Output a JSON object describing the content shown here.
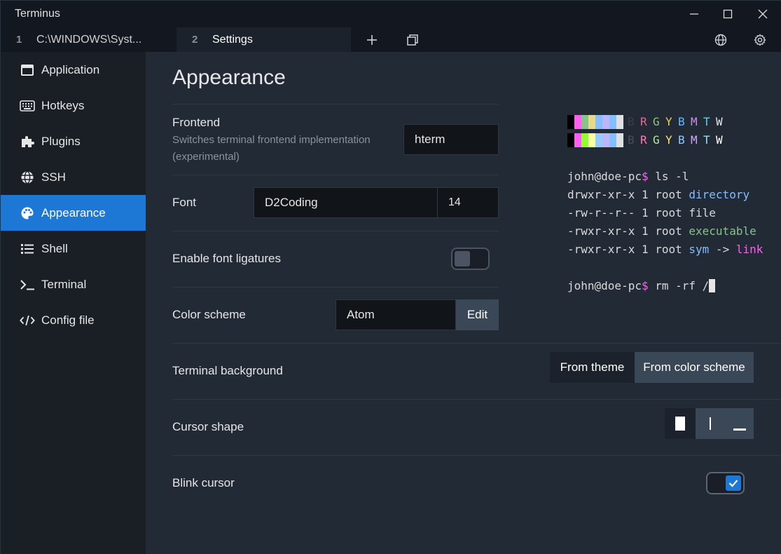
{
  "app": {
    "title": "Terminus"
  },
  "tabs": [
    {
      "num": "1",
      "label": "C:\\WINDOWS\\Syst..."
    },
    {
      "num": "2",
      "label": "Settings"
    }
  ],
  "sidebar": {
    "items": [
      {
        "label": "Application",
        "icon": "window-icon"
      },
      {
        "label": "Hotkeys",
        "icon": "keyboard-icon"
      },
      {
        "label": "Plugins",
        "icon": "puzzle-icon"
      },
      {
        "label": "SSH",
        "icon": "globe-icon"
      },
      {
        "label": "Appearance",
        "icon": "palette-icon",
        "active": true
      },
      {
        "label": "Shell",
        "icon": "list-icon"
      },
      {
        "label": "Terminal",
        "icon": "terminal-icon"
      },
      {
        "label": "Config file",
        "icon": "code-icon"
      }
    ]
  },
  "main": {
    "heading": "Appearance",
    "frontend": {
      "label": "Frontend",
      "description": "Switches terminal frontend implementation (experimental)",
      "value": "hterm"
    },
    "font": {
      "label": "Font",
      "family": "D2Coding",
      "size": "14"
    },
    "ligatures": {
      "label": "Enable font ligatures",
      "enabled": false
    },
    "color_scheme": {
      "label": "Color scheme",
      "value": "Atom",
      "edit_label": "Edit"
    },
    "terminal_background": {
      "label": "Terminal background",
      "options": [
        "From theme",
        "From color scheme"
      ],
      "selected": "From color scheme"
    },
    "cursor_shape": {
      "label": "Cursor shape",
      "options": [
        "block",
        "beam",
        "underline"
      ],
      "selected": "block"
    },
    "blink_cursor": {
      "label": "Blink cursor",
      "enabled": true
    }
  },
  "preview": {
    "letters": [
      "B",
      "R",
      "G",
      "Y",
      "B",
      "M",
      "T",
      "W"
    ],
    "letter_colors_normal": [
      "#3a3f47",
      "#e06c9a",
      "#98c379",
      "#e5d352",
      "#6cb6ff",
      "#c792ea",
      "#6bcbe8",
      "#e6e6e6"
    ],
    "letter_colors_bright": [
      "#4a505a",
      "#ff7ab2",
      "#b6f08a",
      "#ffe16b",
      "#8ec8ff",
      "#d7a6ff",
      "#8fe0f5",
      "#ffffff"
    ],
    "swatch_normal": [
      "#000000",
      "#fd5ff1",
      "#87c38a",
      "#e5d98b",
      "#85befd",
      "#b9b6fc",
      "#85befd",
      "#e0e0e0"
    ],
    "swatch_bright": [
      "#000000",
      "#fd5ff1",
      "#94fa36",
      "#f5ffa8",
      "#96cbfe",
      "#b9b6fc",
      "#85befd",
      "#e0e0e0"
    ],
    "prompt_user": "john@doe-pc",
    "prompt_symbol": "$",
    "command1": " ls -l",
    "listing": [
      {
        "perms": "drwxr-xr-x 1 root ",
        "name": "directory",
        "color": "#85befd"
      },
      {
        "perms": "-rw-r--r-- 1 root ",
        "name": "file",
        "color": "#d9d9d9"
      },
      {
        "perms": "-rwxr-xr-x 1 root ",
        "name": "executable",
        "color": "#87c38a"
      },
      {
        "perms": "-rwxr-xr-x 1 root ",
        "name": "sym",
        "color": "#85befd",
        "arrow": " -> ",
        "target": "link",
        "target_color": "#fd5ff1"
      }
    ],
    "command2": " rm -rf /"
  },
  "colors": {
    "accent": "#1c78d4",
    "prompt_symbol": "#fd5ff1"
  }
}
